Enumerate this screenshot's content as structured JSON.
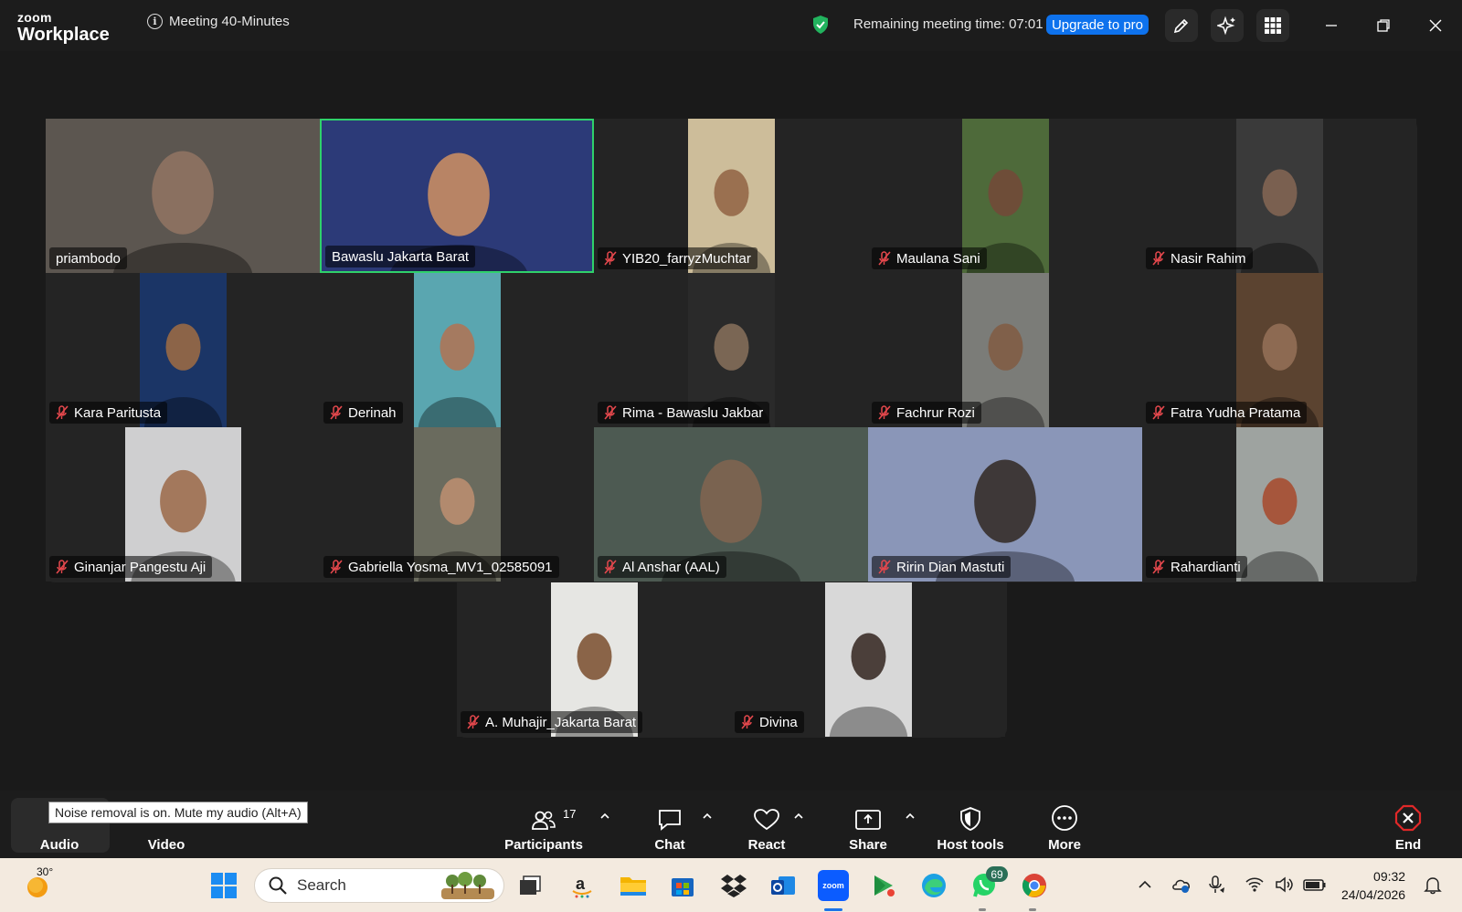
{
  "titlebar": {
    "logo_top": "zoom",
    "logo_bottom": "Workplace",
    "meeting_title": "Meeting 40-Minutes",
    "remaining_time": "Remaining meeting time: 07:01",
    "upgrade_label": "Upgrade to pro",
    "icons": [
      "info-icon",
      "security-shield-icon",
      "pencil-icon",
      "ai-sparkle-icon",
      "apps-grid-icon",
      "minimize-icon",
      "restore-icon",
      "close-icon"
    ],
    "shield_color": "#22b35e",
    "accent_color": "#0e72ed"
  },
  "participants": [
    {
      "name": "priambodo",
      "muted": false,
      "active": false,
      "bg": "#5c5650",
      "face": "#8a7060"
    },
    {
      "name": "Bawaslu Jakarta Barat",
      "muted": false,
      "active": true,
      "bg": "#2c3a78",
      "face": "#b88465"
    },
    {
      "name": "YIB20_farryzMuchtar",
      "muted": true,
      "active": false,
      "bg": "#cdbd9a",
      "face": "#9a7050"
    },
    {
      "name": "Maulana Sani",
      "muted": true,
      "active": false,
      "bg": "#4e6a3a",
      "face": "#6e4d38"
    },
    {
      "name": "Nasir Rahim",
      "muted": true,
      "active": false,
      "bg": "#3a3a3a",
      "face": "#7a6050"
    },
    {
      "name": "Kara Paritusta",
      "muted": true,
      "active": false,
      "bg": "#1b3566",
      "face": "#8c6448"
    },
    {
      "name": "Derinah",
      "muted": true,
      "active": false,
      "bg": "#5aa6b0",
      "face": "#a57a60"
    },
    {
      "name": "Rima - Bawaslu Jakbar",
      "muted": true,
      "active": false,
      "bg": "#2a2a2a",
      "face": "#7a6654"
    },
    {
      "name": "Fachrur Rozi",
      "muted": true,
      "active": false,
      "bg": "#7b7c78",
      "face": "#80604a"
    },
    {
      "name": "Fatra Yudha Pratama",
      "muted": true,
      "active": false,
      "bg": "#5b4330",
      "face": "#8d6a52"
    },
    {
      "name": "Ginanjar Pangestu Aji",
      "muted": true,
      "active": false,
      "bg": "#cfcfd0",
      "face": "#a3785c"
    },
    {
      "name": "Gabriella Yosma_MV1_02585091",
      "muted": true,
      "active": false,
      "bg": "#6a6b5e",
      "face": "#b28a6e"
    },
    {
      "name": "Al Anshar (AAL)",
      "muted": true,
      "active": false,
      "bg": "#4d5a52",
      "face": "#7a6350"
    },
    {
      "name": "Ririn Dian Mastuti",
      "muted": true,
      "active": false,
      "bg": "#8a96b8",
      "face": "#3e3838"
    },
    {
      "name": "Rahardianti",
      "muted": true,
      "active": false,
      "bg": "#9ea3a0",
      "face": "#a6563c"
    },
    {
      "name": "A. Muhajir_Jakarta Barat",
      "muted": true,
      "active": false,
      "bg": "#e6e6e3",
      "face": "#8a6448"
    },
    {
      "name": "Divina",
      "muted": true,
      "active": false,
      "bg": "#d8d8d8",
      "face": "#4b3f3a"
    }
  ],
  "toolbar": {
    "audio_label": "Audio",
    "video_label": "Video",
    "participants_label": "Participants",
    "participants_count": "17",
    "chat_label": "Chat",
    "react_label": "React",
    "share_label": "Share",
    "host_tools_label": "Host tools",
    "more_label": "More",
    "end_label": "End",
    "tooltip": "Noise removal is on. Mute my audio (Alt+A)",
    "end_color": "#e02828"
  },
  "taskbar": {
    "temperature": "30°",
    "search_placeholder": "Search",
    "whatsapp_badge": "69",
    "time": "09:32",
    "date": "24/04/2026",
    "apps": [
      "windows-start-icon",
      "task-view-icon",
      "amazon-icon",
      "file-explorer-icon",
      "store-icon",
      "dropbox-icon",
      "outlook-icon",
      "zoom-icon",
      "play-games-icon",
      "edge-icon",
      "whatsapp-icon",
      "chrome-icon"
    ]
  }
}
